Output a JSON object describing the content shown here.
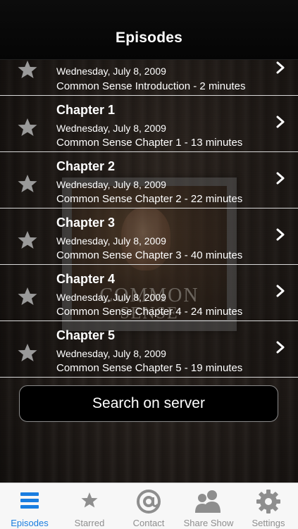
{
  "header": {
    "title": "Episodes"
  },
  "cover": {
    "line1": "COMMON",
    "line2": "SENSE"
  },
  "episodes": [
    {
      "title": "",
      "date": "Wednesday, July 8, 2009",
      "description": "Common Sense Introduction - 2 minutes"
    },
    {
      "title": "Chapter 1",
      "date": "Wednesday, July 8, 2009",
      "description": "Common Sense Chapter 1 - 13 minutes"
    },
    {
      "title": "Chapter 2",
      "date": "Wednesday, July 8, 2009",
      "description": "Common Sense Chapter 2 - 22 minutes"
    },
    {
      "title": "Chapter 3",
      "date": "Wednesday, July 8, 2009",
      "description": "Common Sense Chapter 3 - 40 minutes"
    },
    {
      "title": "Chapter 4",
      "date": "Wednesday, July 8, 2009",
      "description": "Common Sense Chapter 4 - 24 minutes"
    },
    {
      "title": "Chapter 5",
      "date": "Wednesday, July 8, 2009",
      "description": "Common Sense Chapter 5 - 19 minutes"
    }
  ],
  "search_button": {
    "label": "Search on server"
  },
  "tabbar": {
    "tabs": [
      {
        "label": "Episodes",
        "icon": "list-icon",
        "active": true
      },
      {
        "label": "Starred",
        "icon": "star-icon",
        "active": false
      },
      {
        "label": "Contact",
        "icon": "at-sign-icon",
        "active": false
      },
      {
        "label": "Share Show",
        "icon": "people-icon",
        "active": false
      },
      {
        "label": "Settings",
        "icon": "gear-icon",
        "active": false
      }
    ]
  },
  "colors": {
    "accent": "#1a7ee0",
    "inactive_tab": "#8e8e8e",
    "star": "#9a9a9a"
  }
}
